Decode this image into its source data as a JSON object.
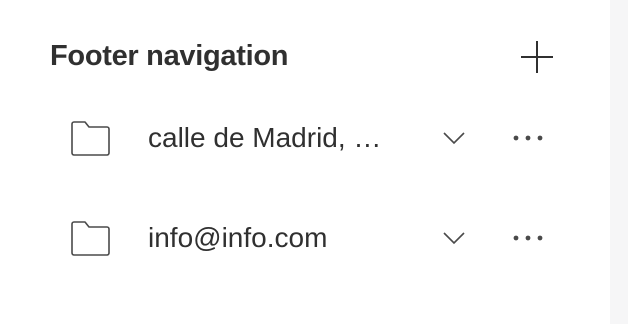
{
  "header": {
    "title": "Footer navigation",
    "add_icon": "plus-icon"
  },
  "items": [
    {
      "label": "calle de Madrid, …",
      "icon": "folder-icon",
      "expand_icon": "chevron-down-icon",
      "menu_icon": "more-horizontal-icon"
    },
    {
      "label": "info@info.com",
      "icon": "folder-icon",
      "expand_icon": "chevron-down-icon",
      "menu_icon": "more-horizontal-icon"
    }
  ],
  "colors": {
    "text": "#303030",
    "icon": "#4a4a4a",
    "background": "#ffffff",
    "side_strip": "#f6f6f7"
  }
}
